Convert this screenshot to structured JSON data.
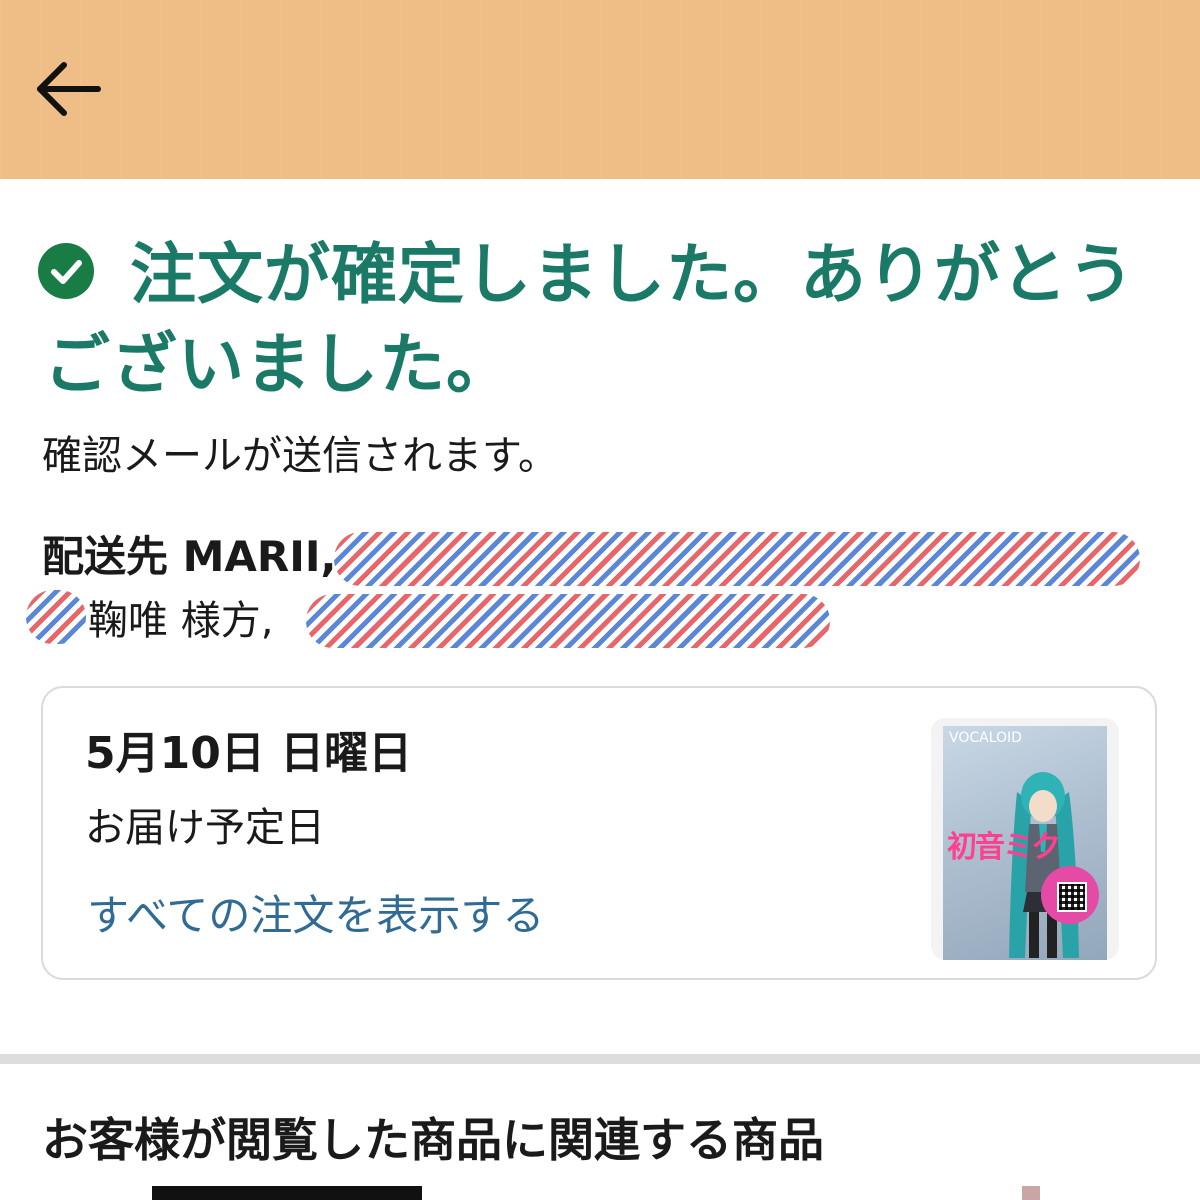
{
  "header": {
    "back_icon": "arrow-left-icon"
  },
  "confirmation": {
    "icon": "check-circle-icon",
    "title": "注文が確定しました。ありがとうございました。",
    "subtitle": "確認メールが送信されます。"
  },
  "shipping": {
    "label_line1": "配送先 MARII,",
    "label_line2": "鞠唯 様方,"
  },
  "order_card": {
    "delivery_date": "5月10日 日曜日",
    "delivery_label": "お届け予定日",
    "view_all_link": "すべての注文を表示する",
    "product_image_text": "VOCALOID",
    "product_logo_text": "初音ミク"
  },
  "related": {
    "title": "お客様が閲覧した商品に関連する商品"
  },
  "colors": {
    "header_bg": "#efbe86",
    "success_green": "#197c45",
    "headline_teal": "#1b7a67",
    "link_blue": "#2f6b95"
  }
}
